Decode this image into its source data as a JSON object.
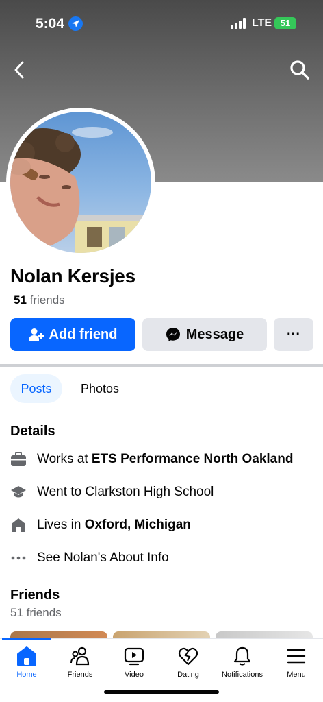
{
  "status_bar": {
    "time": "5:04",
    "network": "LTE",
    "battery": "51"
  },
  "profile": {
    "name": "Nolan Kersjes",
    "friends_count": "51",
    "friends_label": "friends"
  },
  "actions": {
    "add_friend": "Add friend",
    "message": "Message",
    "more": "···"
  },
  "tabs": [
    {
      "label": "Posts",
      "active": true
    },
    {
      "label": "Photos",
      "active": false
    }
  ],
  "details": {
    "title": "Details",
    "work_prefix": "Works at ",
    "work_place": "ETS Performance North Oakland",
    "education": "Went to Clarkston High School",
    "lives_prefix": "Lives in ",
    "lives_place": "Oxford, Michigan",
    "about": "See Nolan's About Info"
  },
  "friends_section": {
    "title": "Friends",
    "count_text": "51 friends"
  },
  "nav": [
    {
      "label": "Home",
      "icon": "home-icon",
      "active": true
    },
    {
      "label": "Friends",
      "icon": "friends-icon",
      "active": false
    },
    {
      "label": "Video",
      "icon": "video-icon",
      "active": false
    },
    {
      "label": "Dating",
      "icon": "dating-icon",
      "active": false
    },
    {
      "label": "Notifications",
      "icon": "bell-icon",
      "active": false
    },
    {
      "label": "Menu",
      "icon": "menu-icon",
      "active": false
    }
  ],
  "colors": {
    "accent": "#0866ff",
    "button_gray": "#e4e6eb",
    "tab_active_bg": "#ebf5ff"
  }
}
